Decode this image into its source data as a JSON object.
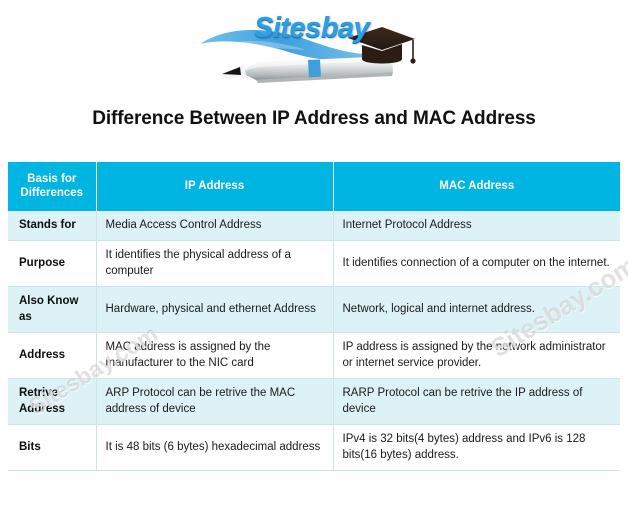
{
  "logo": {
    "brand_text": "Sitesbay",
    "icons": [
      "swoosh-ribbon-icon",
      "pen-icon",
      "graduation-cap-icon"
    ],
    "colors": {
      "brand_blue": "#2b9fe3",
      "swoosh_blue": "#4aa8e0",
      "cap_dark": "#2b1d15",
      "pen_gray": "#d9dcdd"
    }
  },
  "page": {
    "title": "Difference Between IP Address and MAC Address"
  },
  "watermarks": [
    {
      "text": "Sitesbay.com"
    },
    {
      "text": "Sitesbay.com"
    }
  ],
  "table": {
    "accent_color": "#00b5e2",
    "alt_row_color": "#ddf2f7",
    "headers": [
      "Basis for Differences",
      "IP Address",
      "MAC Address"
    ],
    "header_lines": {
      "col1_line1": "Basis for",
      "col1_line2": "Differences",
      "col2": "IP Address",
      "col3": "MAC Address"
    },
    "rows": [
      {
        "basis": "Stands for",
        "ip": "Media Access Control Address",
        "mac": "Internet Protocol Address"
      },
      {
        "basis": "Purpose",
        "ip": "It identifies the physical address of a computer",
        "mac": "It identifies connection of a computer on the internet."
      },
      {
        "basis": "Also Know as",
        "ip": "Hardware, physical and ethernet Address",
        "mac": "Network, logical and internet address."
      },
      {
        "basis": "Address",
        "ip": "MAC address is assigned by the manufacturer to the NIC card",
        "mac": "IP address is assigned by the network administrator or internet service provider."
      },
      {
        "basis": "Retrive Address",
        "ip": "ARP Protocol can be retrive the MAC address of device",
        "mac": "RARP Protocol can be retrive the IP address of device"
      },
      {
        "basis": "Bits",
        "ip": "It is 48 bits (6 bytes) hexadecimal address",
        "mac": "IPv4 is 32 bits(4 bytes) address and IPv6 is 128 bits(16 bytes) address."
      }
    ]
  }
}
